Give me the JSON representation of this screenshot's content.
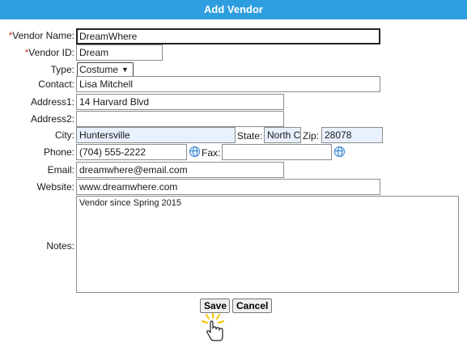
{
  "title": "Add Vendor",
  "form": {
    "vendor_name": {
      "label": "Vendor Name:",
      "required": true,
      "value": "DreamWhere"
    },
    "vendor_id": {
      "label": "Vendor ID:",
      "required": true,
      "value": "Dream"
    },
    "type": {
      "label": "Type:",
      "value": "Costume"
    },
    "contact": {
      "label": "Contact:",
      "value": "Lisa Mitchell"
    },
    "address1": {
      "label": "Address1:",
      "value": "14 Harvard Blvd"
    },
    "address2": {
      "label": "Address2:",
      "value": ""
    },
    "city": {
      "label": "City:",
      "value": "Huntersville"
    },
    "state": {
      "label": "State:",
      "value": "North C"
    },
    "zip": {
      "label": "Zip:",
      "value": "28078"
    },
    "phone": {
      "label": "Phone:",
      "value": "(704) 555-2222"
    },
    "fax": {
      "label": "Fax:",
      "value": ""
    },
    "email": {
      "label": "Email:",
      "value": "dreamwhere@email.com"
    },
    "website": {
      "label": "Website:",
      "value": "www.dreamwhere.com"
    },
    "notes": {
      "label": "Notes:",
      "value": "Vendor since Spring 2015"
    }
  },
  "required_marker": "*",
  "buttons": {
    "save": "Save",
    "cancel": "Cancel"
  },
  "icons": {
    "phone_lookup": "globe-icon",
    "fax_lookup": "globe-icon",
    "cursor": "hand-pointer-icon"
  },
  "colors": {
    "header_bg": "#2e9ee0",
    "required": "#c0392b",
    "autofill_bg": "#e8f0fe"
  }
}
